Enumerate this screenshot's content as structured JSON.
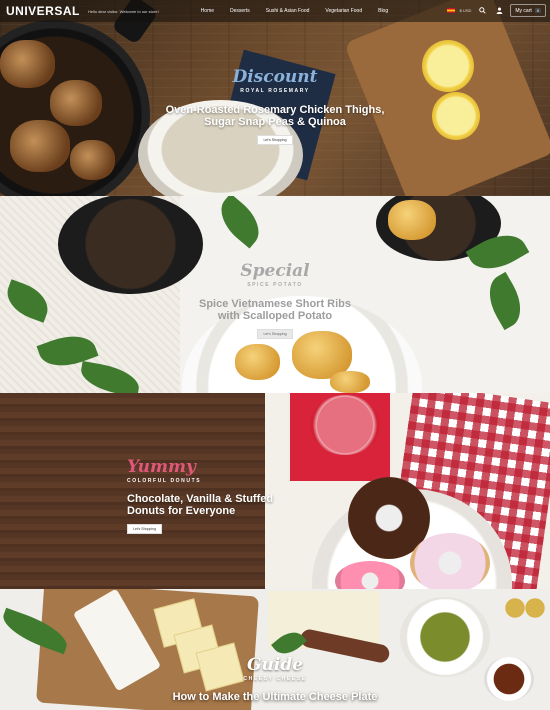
{
  "header": {
    "logo": "UNIVERSAL",
    "tagline": "Hello dear visitor. Welcome to our store!",
    "nav": [
      "Home",
      "Desserts",
      "Sushi & Asian Food",
      "Vegetarian Food",
      "Blog"
    ],
    "currency": "$ USD",
    "cart_label": "My cart",
    "cart_count": "0"
  },
  "banners": [
    {
      "script": "Discount",
      "kicker": "ROYAL ROSEMARY",
      "headline_line1": "Oven-Roasted Rosemary Chicken Thighs,",
      "headline_line2": "Sugar Snap Peas & Quinoa",
      "cta": "Let's Shopping"
    },
    {
      "script": "Special",
      "kicker": "SPICE POTATO",
      "headline_line1": "Spice Vietnamese Short Ribs",
      "headline_line2": "with Scalloped Potato",
      "cta": "Let's Shopping"
    },
    {
      "script": "Yummy",
      "kicker": "COLORFUL DONUTS",
      "headline_line1": "Chocolate, Vanilla & Stuffed",
      "headline_line2": "Donuts for Everyone",
      "cta": "Let's Shopping"
    },
    {
      "script": "Guide",
      "kicker": "CHEESY CHEESE",
      "headline_line1": "How to Make the Ultimate Cheese Plate",
      "headline_line2": ""
    }
  ],
  "colors": {
    "discount_script": "#8ab2db",
    "yummy_script": "#e0577a",
    "special_script": "#a8a8a8"
  },
  "icons": [
    "search-icon",
    "user-icon",
    "cart-icon"
  ]
}
